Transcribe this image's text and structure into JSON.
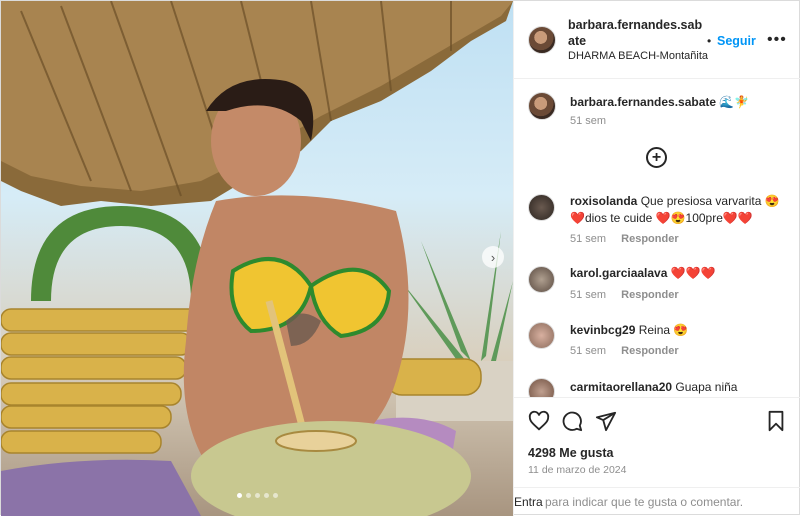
{
  "post": {
    "username": "barbara.fernandes.sabate",
    "username_line1": "barbara.fernandes.sab",
    "username_line2": "ate",
    "separator": "•",
    "follow_label": "Seguir",
    "location": "DHARMA BEACH-Montañita",
    "more_icon": "more-dots-icon",
    "carousel": {
      "total": 5,
      "active": 0
    }
  },
  "caption": {
    "username": "barbara.fernandes.sabate",
    "text": "🌊🧚",
    "time": "51 sem"
  },
  "load_more_icon": "plus-circle-icon",
  "comments": [
    {
      "username": "roxisolanda",
      "text": "Que presiosa varvarita 😍❤️dios te cuide ❤️😍100pre❤️❤️",
      "time": "51 sem",
      "reply": "Responder"
    },
    {
      "username": "karol.garciaalava",
      "text": "❤️❤️❤️",
      "time": "51 sem",
      "reply": "Responder"
    },
    {
      "username": "kevinbcg29",
      "text": "Reina 😍",
      "time": "51 sem",
      "reply": "Responder"
    },
    {
      "username": "carmitaorellana20",
      "text": "Guapa niña",
      "time": "",
      "reply": ""
    }
  ],
  "actions": {
    "like_icon": "heart-icon",
    "comment_icon": "comment-icon",
    "share_icon": "send-icon",
    "save_icon": "bookmark-icon"
  },
  "likes": "4298 Me gusta",
  "date": "11 de marzo de 2024",
  "footer": {
    "login_link": "Entra",
    "rest": "para indicar que te gusta o comentar."
  },
  "colors": {
    "link": "#0095f6",
    "muted": "#8e8e8e",
    "text": "#262626"
  }
}
